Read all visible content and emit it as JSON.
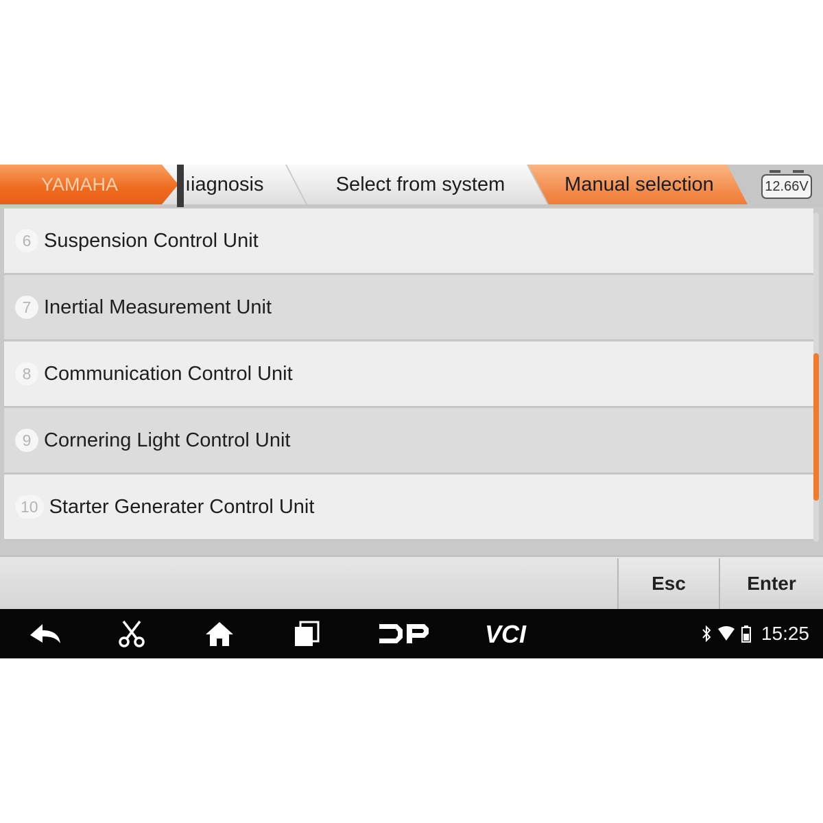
{
  "breadcrumb": {
    "brand": "YAMAHA",
    "step2": "ıiagnosis",
    "step3": "Select from system",
    "step4": "Manual selection"
  },
  "voltage": "12.66V",
  "systems": [
    {
      "num": "6",
      "label": "Suspension Control Unit"
    },
    {
      "num": "7",
      "label": "Inertial Measurement Unit"
    },
    {
      "num": "8",
      "label": "Communication Control Unit"
    },
    {
      "num": "9",
      "label": "Cornering Light Control Unit"
    },
    {
      "num": "10",
      "label": "Starter Generater Control Unit"
    }
  ],
  "actions": {
    "esc": "Esc",
    "enter": "Enter"
  },
  "navbar": {
    "icons": [
      "back-icon",
      "scissors-icon",
      "home-icon",
      "recent-apps-icon",
      "dp-icon",
      "vci-icon"
    ],
    "time": "15:25"
  },
  "colors": {
    "accent": "#f07c2a",
    "nav_bg": "#060606"
  }
}
